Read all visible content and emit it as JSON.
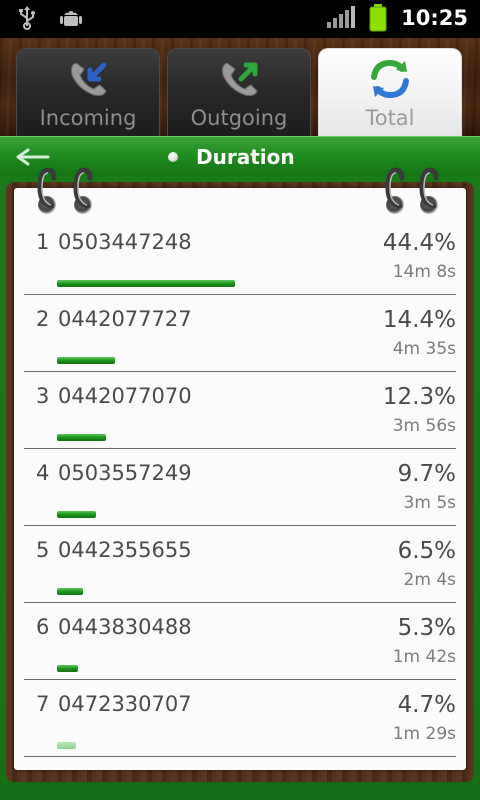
{
  "status_bar": {
    "time": "10:25",
    "icons": [
      "usb-icon",
      "android-debug-icon",
      "signal-icon",
      "battery-icon"
    ]
  },
  "tabs": [
    {
      "label": "Incoming",
      "icon": "incoming-call-icon",
      "active": false
    },
    {
      "label": "Outgoing",
      "icon": "outgoing-call-icon",
      "active": false
    },
    {
      "label": "Total",
      "icon": "refresh-total-icon",
      "active": true
    }
  ],
  "header": {
    "title": "Duration",
    "back_icon": "back-arrow-icon"
  },
  "colors": {
    "accent_green": "#1f8a1f",
    "bar_green": "#1f9a1f",
    "text": "#4a4a4a"
  },
  "list": [
    {
      "rank": "1",
      "number": "0503447248",
      "percent": "44.4%",
      "duration": "14m 8s",
      "share": 0.444
    },
    {
      "rank": "2",
      "number": "0442077727",
      "percent": "14.4%",
      "duration": "4m 35s",
      "share": 0.144
    },
    {
      "rank": "3",
      "number": "0442077070",
      "percent": "12.3%",
      "duration": "3m 56s",
      "share": 0.123
    },
    {
      "rank": "4",
      "number": " 0503557249",
      "percent": "9.7%",
      "duration": "3m 5s",
      "share": 0.097
    },
    {
      "rank": "5",
      "number": "0442355655",
      "percent": "6.5%",
      "duration": "2m 4s",
      "share": 0.065
    },
    {
      "rank": "6",
      "number": "0443830488",
      "percent": "5.3%",
      "duration": "1m 42s",
      "share": 0.053
    },
    {
      "rank": "7",
      "number": "0472330707",
      "percent": "4.7%",
      "duration": "1m 29s",
      "share": 0.047
    }
  ]
}
